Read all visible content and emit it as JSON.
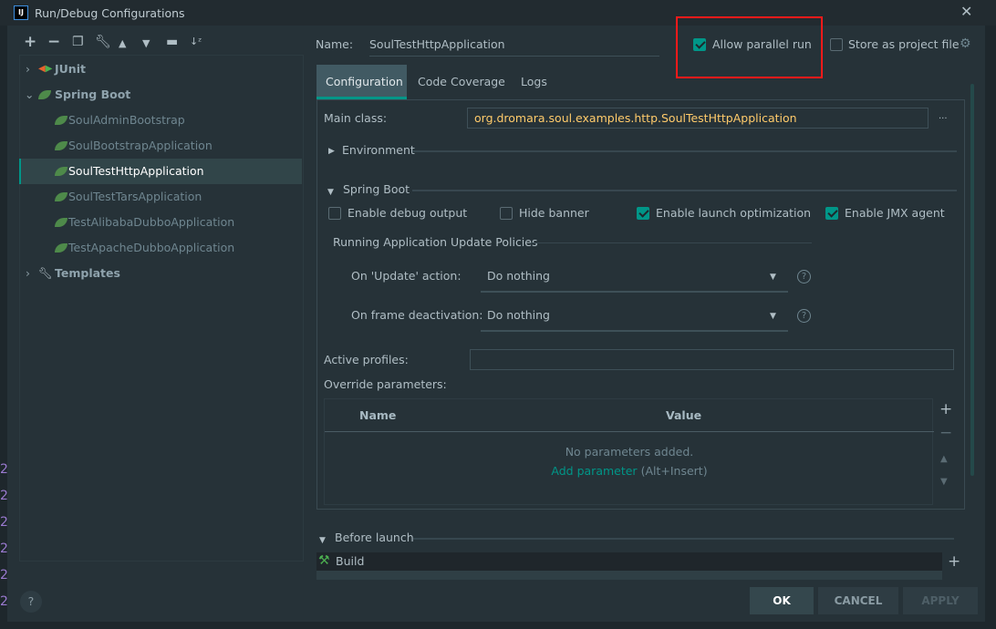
{
  "window": {
    "title": "Run/Debug Configurations",
    "logo": "IJ"
  },
  "toolbar": {
    "icons": [
      "plus-icon",
      "minus-icon",
      "copy-icon",
      "wrench-icon",
      "arrow-up-icon",
      "arrow-down-icon",
      "new-folder-icon",
      "sort-az-icon"
    ]
  },
  "tree": {
    "junit": "JUnit",
    "spring_boot": "Spring Boot",
    "children": [
      "SoulAdminBootstrap",
      "SoulBootstrapApplication",
      "SoulTestHttpApplication",
      "SoulTestTarsApplication",
      "TestAlibabaDubboApplication",
      "TestApacheDubboApplication"
    ],
    "selected": "SoulTestHttpApplication",
    "templates": "Templates"
  },
  "header": {
    "name_label": "Name:",
    "name_value": "SoulTestHttpApplication",
    "allow_parallel": "Allow parallel run",
    "allow_parallel_checked": true,
    "store_project": "Store as project file",
    "store_project_checked": false
  },
  "tabs": [
    "Configuration",
    "Code Coverage",
    "Logs"
  ],
  "active_tab": "Configuration",
  "config": {
    "main_class_label": "Main class:",
    "main_class_value": "org.dromara.soul.examples.http.SoulTestHttpApplication",
    "browse": "...",
    "environment": "Environment",
    "spring_boot": "Spring Boot",
    "checks": [
      {
        "label": "Enable debug output",
        "checked": false
      },
      {
        "label": "Hide banner",
        "checked": false
      },
      {
        "label": "Enable launch optimization",
        "checked": true
      },
      {
        "label": "Enable JMX agent",
        "checked": true
      }
    ],
    "policies_title": "Running Application Update Policies",
    "update_label": "On 'Update' action:",
    "update_value": "Do nothing",
    "frame_label": "On frame deactivation:",
    "frame_value": "Do nothing",
    "active_profiles_label": "Active profiles:",
    "active_profiles_value": "",
    "override_label": "Override parameters:",
    "table": {
      "columns": [
        "Name",
        "Value"
      ],
      "empty": "No parameters added.",
      "add_link": "Add parameter",
      "add_hint": "(Alt+Insert)"
    }
  },
  "before_launch": {
    "title": "Before launch",
    "items": [
      "Build"
    ]
  },
  "footer": {
    "help": "?",
    "ok": "OK",
    "cancel": "CANCEL",
    "apply": "APPLY"
  },
  "background_gutter": [
    "2",
    "2",
    "2",
    "2",
    "2",
    "2"
  ],
  "colors": {
    "accent": "#009688",
    "background": "#263238",
    "highlight": "#ff1a1a",
    "main_class_text": "#ffcb6b"
  }
}
